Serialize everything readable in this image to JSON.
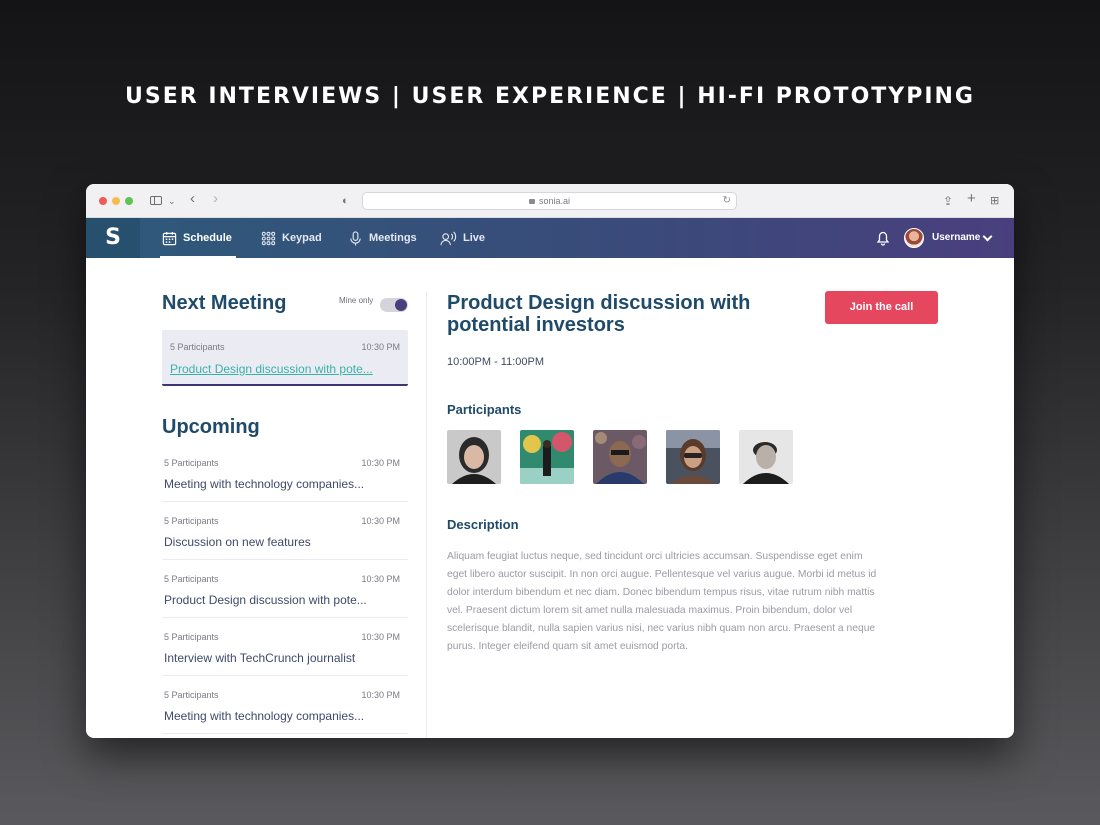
{
  "headline": "USER INTERVIEWS  |  USER EXPERIENCE  |  HI-FI PROTOTYPING",
  "browser": {
    "url": "sonia.ai"
  },
  "navbar": {
    "logo": "S",
    "tabs": [
      {
        "label": "Schedule",
        "icon": "calendar-icon",
        "active": true
      },
      {
        "label": "Keypad",
        "icon": "keypad-icon",
        "active": false
      },
      {
        "label": "Meetings",
        "icon": "microphone-icon",
        "active": false
      },
      {
        "label": "Live",
        "icon": "live-icon",
        "active": false
      }
    ],
    "username": "Username"
  },
  "next_meeting": {
    "title": "Next Meeting",
    "filter_label": "Mine only",
    "filter_on": true,
    "card": {
      "participants": "5 Participants",
      "time": "10:30 PM",
      "title": "Product Design discussion with pote..."
    }
  },
  "upcoming": {
    "title": "Upcoming",
    "items": [
      {
        "participants": "5 Participants",
        "time": "10:30 PM",
        "title": "Meeting with technology companies..."
      },
      {
        "participants": "5 Participants",
        "time": "10:30 PM",
        "title": "Discussion on new features"
      },
      {
        "participants": "5 Participants",
        "time": "10:30 PM",
        "title": "Product Design discussion with pote..."
      },
      {
        "participants": "5 Participants",
        "time": "10:30 PM",
        "title": "Interview with TechCrunch journalist"
      },
      {
        "participants": "5 Participants",
        "time": "10:30 PM",
        "title": "Meeting with technology companies..."
      }
    ]
  },
  "detail": {
    "title": "Product Design discussion with potential investors",
    "join_label": "Join the call",
    "time_range": "10:00PM - 11:00PM",
    "participants_title": "Participants",
    "description_title": "Description",
    "description": "Aliquam feugiat luctus neque, sed tincidunt orci ultricies accumsan. Suspendisse eget enim eget libero auctor suscipit. In non orci augue. Pellentesque vel varius augue. Morbi id metus id dolor interdum bibendum et nec diam. Donec bibendum tempus risus, vitae rutrum nibh mattis vel. Praesent dictum lorem sit amet nulla malesuada maximus. Proin bibendum, dolor vel scelerisque blandit, nulla sapien varius nisi, nec varius nibh quam non arcu. Praesent a neque purus. Integer eleifend quam sit amet euismod porta."
  },
  "colors": {
    "accent": "#1f4a6a",
    "join": "#e5475e",
    "link": "#38b2a8",
    "toggle": "#4a3f7e"
  }
}
